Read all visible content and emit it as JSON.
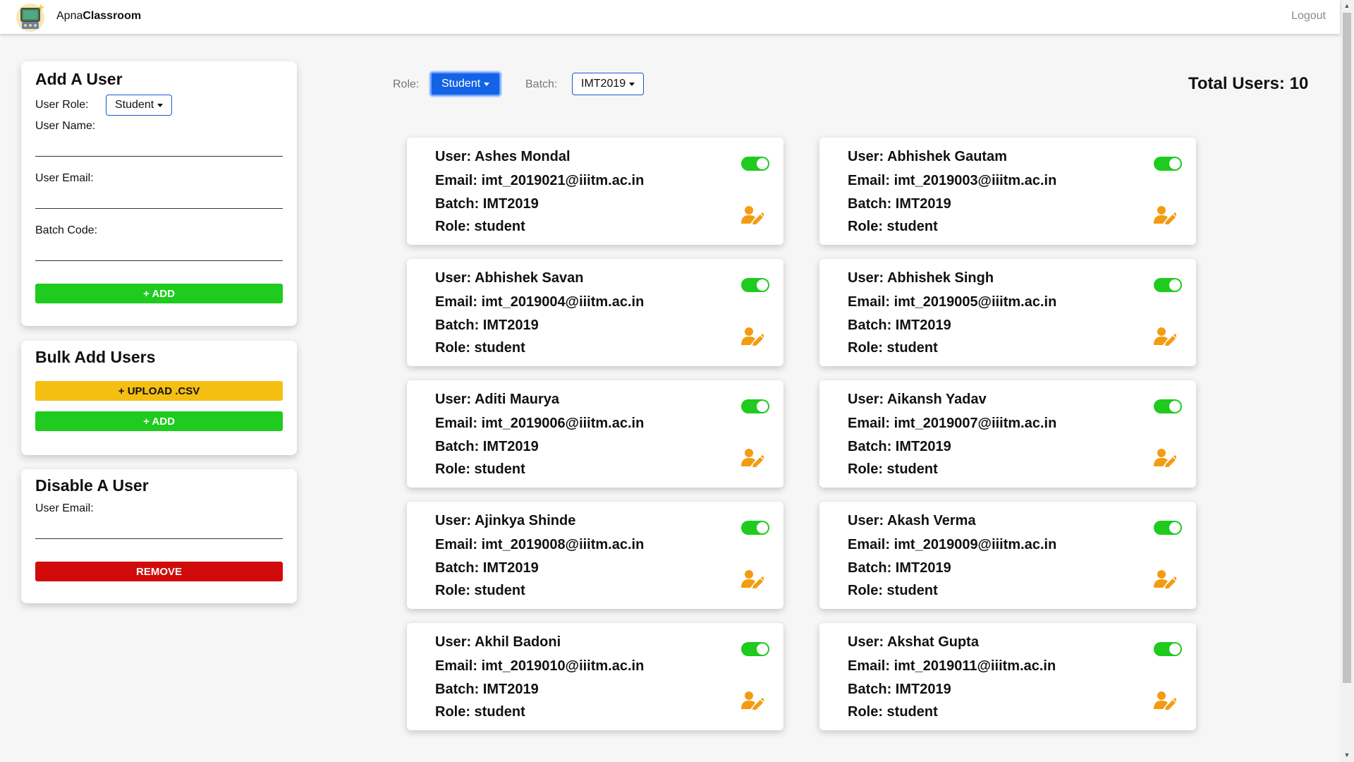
{
  "app": {
    "brand_prefix": "Apna",
    "brand_bold": "Classroom",
    "logout_label": "Logout"
  },
  "add_user": {
    "title": "Add A User",
    "role_label": "User Role:",
    "role_value": "Student",
    "name_label": "User Name:",
    "email_label": "User Email:",
    "batch_label": "Batch Code:",
    "add_label": "+ ADD"
  },
  "bulk_add": {
    "title": "Bulk Add Users",
    "upload_label": "+ UPLOAD .CSV",
    "add_label": "+ ADD"
  },
  "disable_user": {
    "title": "Disable A User",
    "email_label": "User Email:",
    "remove_label": "REMOVE"
  },
  "filters": {
    "role_label": "Role:",
    "role_value": "Student",
    "batch_label": "Batch:",
    "batch_value": "IMT2019"
  },
  "total_users": "Total Users: 10",
  "colors": {
    "accent": "#1463e6",
    "add": "#1ecb1e",
    "upload": "#f4bf12",
    "remove": "#d10b0b",
    "toggle_on": "#1ecb1e",
    "edit_icon": "#f39c12"
  },
  "users": [
    {
      "user": "User:  Ashes Mondal",
      "email": "Email:  imt_2019021@iiitm.ac.in",
      "batch": "Batch: IMT2019",
      "role": "Role: student",
      "enabled": true
    },
    {
      "user": "User:  Abhishek Gautam",
      "email": "Email:  imt_2019003@iiitm.ac.in",
      "batch": "Batch: IMT2019",
      "role": "Role: student",
      "enabled": true
    },
    {
      "user": "User:  Abhishek Savan",
      "email": "Email:  imt_2019004@iiitm.ac.in",
      "batch": "Batch: IMT2019",
      "role": "Role: student",
      "enabled": true
    },
    {
      "user": "User:  Abhishek Singh",
      "email": "Email:  imt_2019005@iiitm.ac.in",
      "batch": "Batch: IMT2019",
      "role": "Role: student",
      "enabled": true
    },
    {
      "user": "User:  Aditi Maurya",
      "email": "Email:  imt_2019006@iiitm.ac.in",
      "batch": "Batch: IMT2019",
      "role": "Role: student",
      "enabled": true
    },
    {
      "user": "User:  Aikansh Yadav",
      "email": "Email:  imt_2019007@iiitm.ac.in",
      "batch": "Batch: IMT2019",
      "role": "Role: student",
      "enabled": true
    },
    {
      "user": "User:  Ajinkya Shinde",
      "email": "Email:  imt_2019008@iiitm.ac.in",
      "batch": "Batch: IMT2019",
      "role": "Role: student",
      "enabled": true
    },
    {
      "user": "User:  Akash Verma",
      "email": "Email:  imt_2019009@iiitm.ac.in",
      "batch": "Batch: IMT2019",
      "role": "Role: student",
      "enabled": true
    },
    {
      "user": "User:  Akhil Badoni",
      "email": "Email:  imt_2019010@iiitm.ac.in",
      "batch": "Batch: IMT2019",
      "role": "Role: student",
      "enabled": true
    },
    {
      "user": "User:  Akshat Gupta",
      "email": "Email:  imt_2019011@iiitm.ac.in",
      "batch": "Batch: IMT2019",
      "role": "Role: student",
      "enabled": true
    }
  ]
}
